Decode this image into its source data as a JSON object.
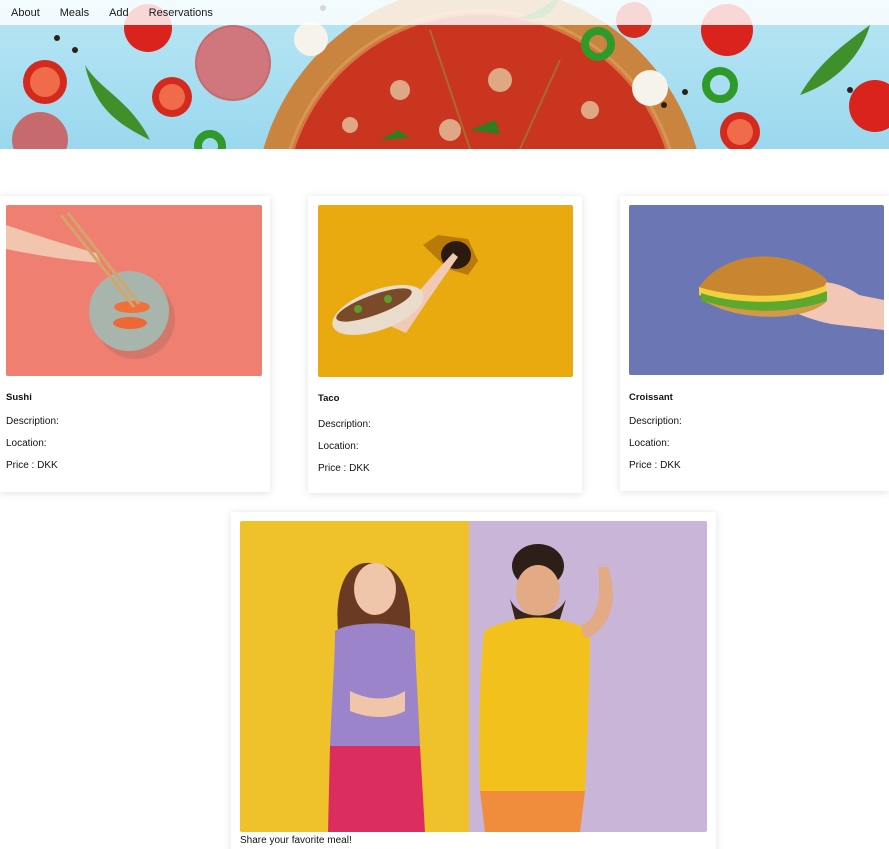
{
  "nav": {
    "items": [
      {
        "label": "About"
      },
      {
        "label": "Meals"
      },
      {
        "label": "Add"
      },
      {
        "label": "Reservations"
      }
    ]
  },
  "hero": {
    "image": "pizza-and-ingredients-banner"
  },
  "meals": [
    {
      "name": "Sushi",
      "description": "Description:",
      "location": "Location:",
      "price": "Price : DKK",
      "image": "hand-with-chopsticks-and-sushi",
      "bg": "#ef7f70"
    },
    {
      "name": "Taco",
      "description": "Description:",
      "location": "Location:",
      "price": "Price : DKK",
      "image": "hand-holding-taco-through-paper",
      "bg": "#e9aa10"
    },
    {
      "name": "Croissant",
      "description": "Description:",
      "location": "Location:",
      "price": "Price : DKK",
      "image": "hand-holding-croissant-sandwich",
      "bg": "#6b77b5"
    }
  ],
  "share": {
    "caption": "Share your favorite meal!",
    "image": "hungry-woman-and-man-with-idea"
  },
  "colors": {
    "hero_sky": "#9ad8ee",
    "card_bg": "#ffffff"
  }
}
